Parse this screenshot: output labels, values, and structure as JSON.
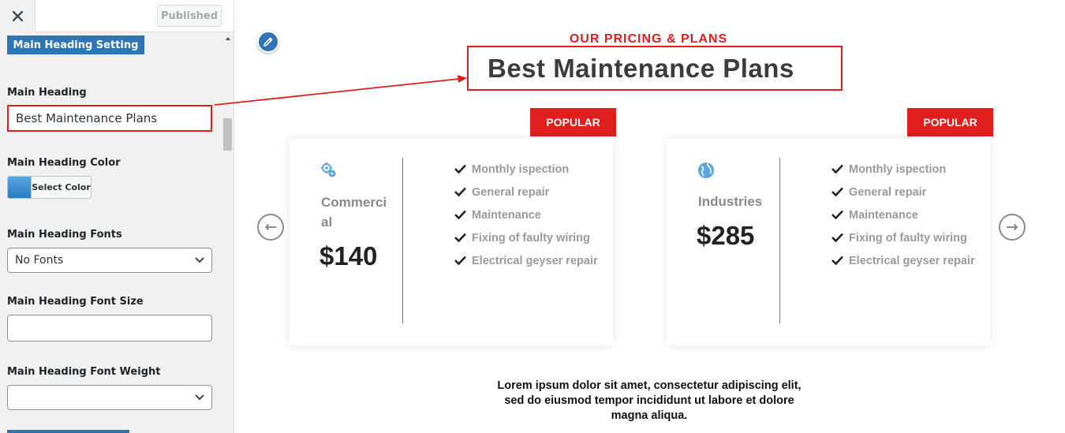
{
  "sidebar": {
    "close_icon": "close-icon",
    "publish_label": "Published",
    "section_label": "Main Heading Setting",
    "fields": {
      "heading_label": "Main Heading",
      "heading_value": "Best Maintenance Plans",
      "color_label": "Main Heading Color",
      "color_button": "Select Color",
      "fonts_label": "Main Heading Fonts",
      "fonts_value": "No Fonts",
      "font_size_label": "Main Heading Font Size",
      "font_size_value": "",
      "font_weight_label": "Main Heading Font Weight",
      "font_weight_value": ""
    }
  },
  "preview": {
    "subtitle": "OUR PRICING & PLANS",
    "heading": "Best Maintenance Plans",
    "description": "Lorem ipsum dolor sit amet, consectetur adipiscing elit, sed do eiusmod tempor incididunt ut labore et dolore magna aliqua.",
    "plans": [
      {
        "badge": "POPULAR",
        "icon": "gears-icon",
        "name": "Commercial",
        "price": "$140",
        "features": [
          "Monthly ispection",
          "General repair",
          "Maintenance",
          "Fixing of faulty wiring",
          "Electrical geyser repair"
        ]
      },
      {
        "badge": "POPULAR",
        "icon": "globe-icon",
        "name": "Industries",
        "price": "$285",
        "features": [
          "Monthly ispection",
          "General repair",
          "Maintenance",
          "Fixing of faulty wiring",
          "Electrical geyser repair"
        ]
      }
    ]
  },
  "colors": {
    "accent_red": "#e01e1e",
    "brand_blue": "#2f74b5",
    "icon_blue": "#5aa6e0"
  }
}
